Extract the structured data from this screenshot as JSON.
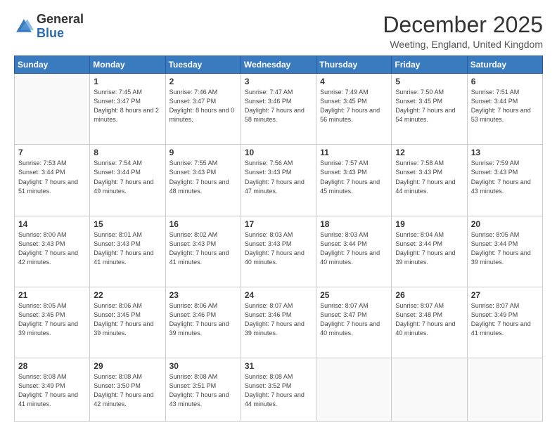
{
  "logo": {
    "general": "General",
    "blue": "Blue"
  },
  "header": {
    "month": "December 2025",
    "location": "Weeting, England, United Kingdom"
  },
  "weekdays": [
    "Sunday",
    "Monday",
    "Tuesday",
    "Wednesday",
    "Thursday",
    "Friday",
    "Saturday"
  ],
  "weeks": [
    [
      {
        "day": "",
        "info": ""
      },
      {
        "day": "1",
        "sunrise": "7:45 AM",
        "sunset": "3:47 PM",
        "daylight": "8 hours and 2 minutes."
      },
      {
        "day": "2",
        "sunrise": "7:46 AM",
        "sunset": "3:47 PM",
        "daylight": "8 hours and 0 minutes."
      },
      {
        "day": "3",
        "sunrise": "7:47 AM",
        "sunset": "3:46 PM",
        "daylight": "7 hours and 58 minutes."
      },
      {
        "day": "4",
        "sunrise": "7:49 AM",
        "sunset": "3:45 PM",
        "daylight": "7 hours and 56 minutes."
      },
      {
        "day": "5",
        "sunrise": "7:50 AM",
        "sunset": "3:45 PM",
        "daylight": "7 hours and 54 minutes."
      },
      {
        "day": "6",
        "sunrise": "7:51 AM",
        "sunset": "3:44 PM",
        "daylight": "7 hours and 53 minutes."
      }
    ],
    [
      {
        "day": "7",
        "sunrise": "7:53 AM",
        "sunset": "3:44 PM",
        "daylight": "7 hours and 51 minutes."
      },
      {
        "day": "8",
        "sunrise": "7:54 AM",
        "sunset": "3:44 PM",
        "daylight": "7 hours and 49 minutes."
      },
      {
        "day": "9",
        "sunrise": "7:55 AM",
        "sunset": "3:43 PM",
        "daylight": "7 hours and 48 minutes."
      },
      {
        "day": "10",
        "sunrise": "7:56 AM",
        "sunset": "3:43 PM",
        "daylight": "7 hours and 47 minutes."
      },
      {
        "day": "11",
        "sunrise": "7:57 AM",
        "sunset": "3:43 PM",
        "daylight": "7 hours and 45 minutes."
      },
      {
        "day": "12",
        "sunrise": "7:58 AM",
        "sunset": "3:43 PM",
        "daylight": "7 hours and 44 minutes."
      },
      {
        "day": "13",
        "sunrise": "7:59 AM",
        "sunset": "3:43 PM",
        "daylight": "7 hours and 43 minutes."
      }
    ],
    [
      {
        "day": "14",
        "sunrise": "8:00 AM",
        "sunset": "3:43 PM",
        "daylight": "7 hours and 42 minutes."
      },
      {
        "day": "15",
        "sunrise": "8:01 AM",
        "sunset": "3:43 PM",
        "daylight": "7 hours and 41 minutes."
      },
      {
        "day": "16",
        "sunrise": "8:02 AM",
        "sunset": "3:43 PM",
        "daylight": "7 hours and 41 minutes."
      },
      {
        "day": "17",
        "sunrise": "8:03 AM",
        "sunset": "3:43 PM",
        "daylight": "7 hours and 40 minutes."
      },
      {
        "day": "18",
        "sunrise": "8:03 AM",
        "sunset": "3:44 PM",
        "daylight": "7 hours and 40 minutes."
      },
      {
        "day": "19",
        "sunrise": "8:04 AM",
        "sunset": "3:44 PM",
        "daylight": "7 hours and 39 minutes."
      },
      {
        "day": "20",
        "sunrise": "8:05 AM",
        "sunset": "3:44 PM",
        "daylight": "7 hours and 39 minutes."
      }
    ],
    [
      {
        "day": "21",
        "sunrise": "8:05 AM",
        "sunset": "3:45 PM",
        "daylight": "7 hours and 39 minutes."
      },
      {
        "day": "22",
        "sunrise": "8:06 AM",
        "sunset": "3:45 PM",
        "daylight": "7 hours and 39 minutes."
      },
      {
        "day": "23",
        "sunrise": "8:06 AM",
        "sunset": "3:46 PM",
        "daylight": "7 hours and 39 minutes."
      },
      {
        "day": "24",
        "sunrise": "8:07 AM",
        "sunset": "3:46 PM",
        "daylight": "7 hours and 39 minutes."
      },
      {
        "day": "25",
        "sunrise": "8:07 AM",
        "sunset": "3:47 PM",
        "daylight": "7 hours and 40 minutes."
      },
      {
        "day": "26",
        "sunrise": "8:07 AM",
        "sunset": "3:48 PM",
        "daylight": "7 hours and 40 minutes."
      },
      {
        "day": "27",
        "sunrise": "8:07 AM",
        "sunset": "3:49 PM",
        "daylight": "7 hours and 41 minutes."
      }
    ],
    [
      {
        "day": "28",
        "sunrise": "8:08 AM",
        "sunset": "3:49 PM",
        "daylight": "7 hours and 41 minutes."
      },
      {
        "day": "29",
        "sunrise": "8:08 AM",
        "sunset": "3:50 PM",
        "daylight": "7 hours and 42 minutes."
      },
      {
        "day": "30",
        "sunrise": "8:08 AM",
        "sunset": "3:51 PM",
        "daylight": "7 hours and 43 minutes."
      },
      {
        "day": "31",
        "sunrise": "8:08 AM",
        "sunset": "3:52 PM",
        "daylight": "7 hours and 44 minutes."
      },
      {
        "day": "",
        "info": ""
      },
      {
        "day": "",
        "info": ""
      },
      {
        "day": "",
        "info": ""
      }
    ]
  ],
  "labels": {
    "sunrise": "Sunrise:",
    "sunset": "Sunset:",
    "daylight": "Daylight:"
  }
}
